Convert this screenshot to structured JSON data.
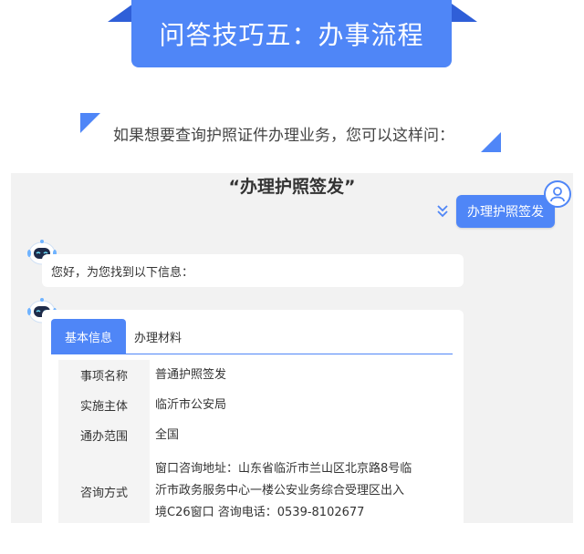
{
  "banner": {
    "title": "问答技巧五：办事流程"
  },
  "intro": {
    "text": "如果想要查询护照证件办理业务，您可以这样问："
  },
  "chat": {
    "query_title": "“办理护照签发”",
    "user_message": "办理护照签发",
    "bot_greeting": "您好，为您找到以下信息：",
    "tabs": [
      {
        "label": "基本信息",
        "active": true
      },
      {
        "label": "办理材料",
        "active": false
      }
    ],
    "info_rows": [
      {
        "label": "事项名称",
        "value": "普通护照签发"
      },
      {
        "label": "实施主体",
        "value": "临沂市公安局"
      },
      {
        "label": "通办范围",
        "value": "全国"
      },
      {
        "label": "咨询方式",
        "value_lines": [
          "窗口咨询地址：山东省临沂市兰山区北京路8号临",
          "沂市政务服务中心一楼公安业务综合受理区出入",
          "境C26窗口 咨询电话：0539-8102677"
        ]
      }
    ]
  },
  "colors": {
    "accent": "#4f86f7",
    "accent_dark": "#2f5fd8",
    "panel_bg": "#f2f2f2"
  },
  "icons": [
    "user-avatar-icon",
    "robot-avatar-icon",
    "chevron-double-down-icon"
  ]
}
